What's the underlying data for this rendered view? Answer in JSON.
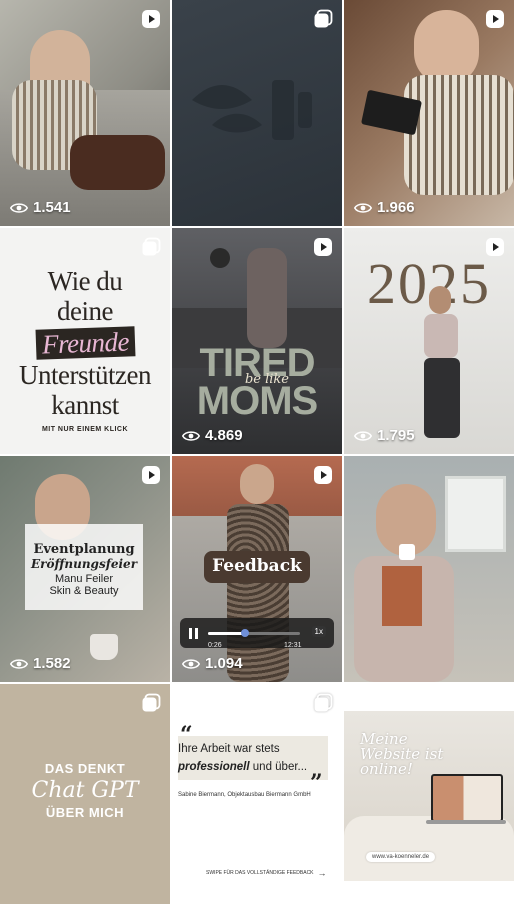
{
  "posts": [
    {
      "type": "reel",
      "views": "1.541"
    },
    {
      "type": "carousel"
    },
    {
      "type": "reel",
      "views": "1.966"
    },
    {
      "type": "carousel",
      "lines": [
        "Wie du",
        "deine",
        "Freunde",
        "Unterstützen",
        "kannst"
      ],
      "footer": "MIT NUR EINEM KLICK"
    },
    {
      "type": "reel",
      "views": "4.869",
      "title_top": "TIRED",
      "title_mid": "be like",
      "title_bottom": "MOMS"
    },
    {
      "type": "reel",
      "views": "1.795",
      "year": "2025"
    },
    {
      "type": "reel",
      "views": "1.582",
      "title": "Eventplanung",
      "subtitle": "Eröffnungsfeier",
      "line1": "Manu Feiler",
      "line2": "Skin & Beauty"
    },
    {
      "type": "reel",
      "views": "1.094",
      "label": "Feedback",
      "time_elapsed": "0:26",
      "time_total": "12:31",
      "speed": "1x",
      "progress": 0.4
    },
    {
      "type": "image"
    },
    {
      "type": "carousel",
      "line1": "DAS DENKT",
      "line2": "Chat GPT",
      "line3": "ÜBER MICH"
    },
    {
      "type": "carousel",
      "quote_line1": "Ihre Arbeit war stets",
      "quote_bold": "professionell",
      "quote_rest": " und über...",
      "author": "Sabine Biermann, Objektausbau Biermann GmbH",
      "swipe": "SWIPE FÜR DAS VOLLSTÄNDIGE FEEDBACK"
    },
    {
      "type": "image",
      "title_line1": "Meine",
      "title_line2": "Website ist",
      "title_line3": "online!",
      "url": "www.va-koenneler.de"
    }
  ],
  "colors": {
    "accent_pink": "#e8b7d4",
    "beige": "#c0b4a0",
    "dark_slate": "#30373f"
  },
  "icons": {
    "reel": "reel-icon",
    "carousel": "carousel-icon",
    "views": "eye-icon"
  }
}
